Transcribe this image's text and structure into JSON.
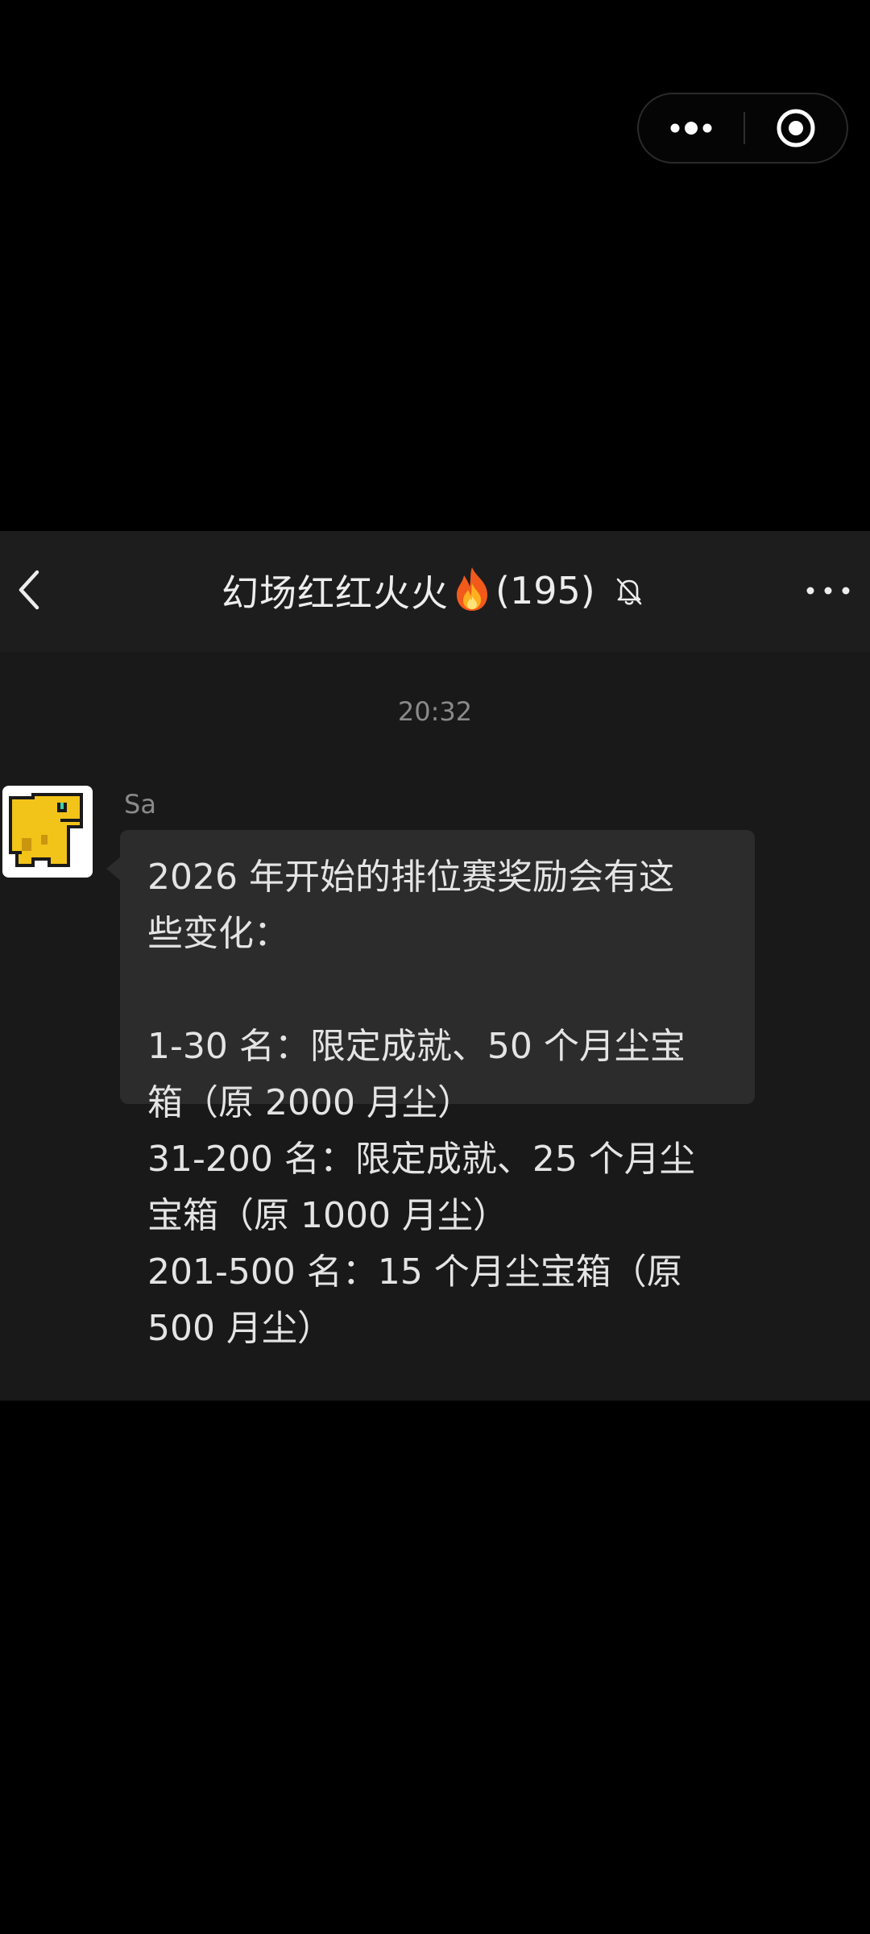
{
  "capsule": {
    "more_icon": "ellipsis-icon",
    "close_icon": "target-circle-icon"
  },
  "nav": {
    "back_icon": "chevron-left-icon",
    "title": "幻场红红火火",
    "title_emoji_icon": "fire-icon",
    "member_count": "(195)",
    "mute_icon": "bell-off-icon",
    "menu_icon": "ellipsis-icon"
  },
  "chat": {
    "timestamp": "20:32",
    "message": {
      "sender": "Sa",
      "avatar_icon": "pixel-dinosaur-avatar",
      "lines": [
        "2026 年开始的排位赛奖励会有这",
        "些变化：",
        "",
        "1-30 名：限定成就、50 个月尘宝",
        "箱（原 2000 月尘）",
        "31-200 名：限定成就、25 个月尘",
        "宝箱（原 1000 月尘）",
        "201-500 名：15 个月尘宝箱（原",
        "500 月尘）"
      ]
    }
  },
  "colors": {
    "page_background": "#000000",
    "chat_background": "#191919",
    "nav_background": "#1d1d1d",
    "bubble_background": "#2c2c2c",
    "text_primary": "#e4e4e4",
    "text_secondary": "#8a8a8a"
  }
}
